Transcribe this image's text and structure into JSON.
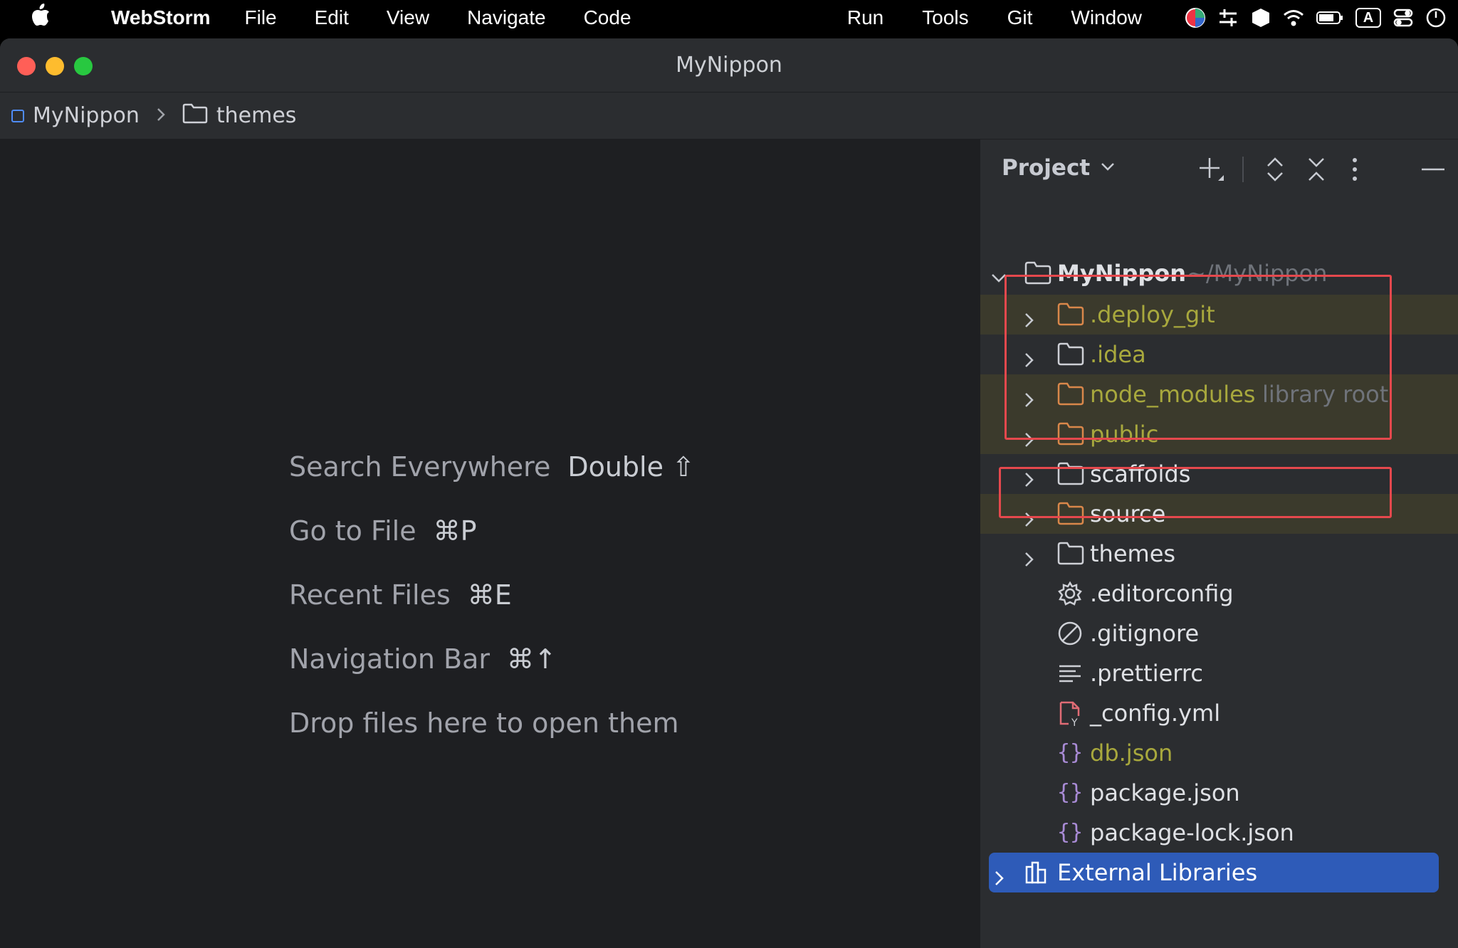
{
  "menubar": {
    "app_name": "WebStorm",
    "menus": [
      "File",
      "Edit",
      "View",
      "Navigate",
      "Code"
    ],
    "right_menus": [
      "Run",
      "Tools",
      "Git",
      "Window"
    ],
    "input_source": "A"
  },
  "window": {
    "title": "MyNippon"
  },
  "breadcrumb": {
    "project": "MyNippon",
    "folder": "themes"
  },
  "editor": {
    "hints": [
      {
        "label": "Search Everywhere",
        "shortcut": "Double ⇧"
      },
      {
        "label": "Go to File",
        "shortcut": "⌘P"
      },
      {
        "label": "Recent Files",
        "shortcut": "⌘E"
      },
      {
        "label": "Navigation Bar",
        "shortcut": "⌘↑"
      }
    ],
    "drop_hint": "Drop files here to open them"
  },
  "project_panel": {
    "title": "Project",
    "root": {
      "name": "MyNippon",
      "path": "~/MyNippon"
    },
    "items": [
      {
        "name": ".deploy_git",
        "type": "folder",
        "color": "yellow"
      },
      {
        "name": ".idea",
        "type": "folder",
        "color": "yellow"
      },
      {
        "name": "node_modules",
        "suffix": "library root",
        "type": "folder",
        "color": "yellow"
      },
      {
        "name": "public",
        "type": "folder",
        "color": "yellow"
      },
      {
        "name": "scaffolds",
        "type": "folder",
        "color": "white"
      },
      {
        "name": "source",
        "type": "folder",
        "color": "white"
      },
      {
        "name": "themes",
        "type": "folder",
        "color": "white"
      },
      {
        "name": ".editorconfig",
        "type": "gear-file",
        "color": "white"
      },
      {
        "name": ".gitignore",
        "type": "ignore-file",
        "color": "white"
      },
      {
        "name": ".prettierrc",
        "type": "text-file",
        "color": "white"
      },
      {
        "name": "_config.yml",
        "type": "yaml-file",
        "color": "white"
      },
      {
        "name": "db.json",
        "type": "json-file",
        "color": "yellow"
      },
      {
        "name": "package.json",
        "type": "json-file",
        "color": "white"
      },
      {
        "name": "package-lock.json",
        "type": "json-file",
        "color": "white"
      }
    ],
    "external": "External Libraries"
  },
  "colors": {
    "accent": "#2e5bb8",
    "highlight_box": "#e5484d",
    "ignored_text": "#a8a83d"
  }
}
